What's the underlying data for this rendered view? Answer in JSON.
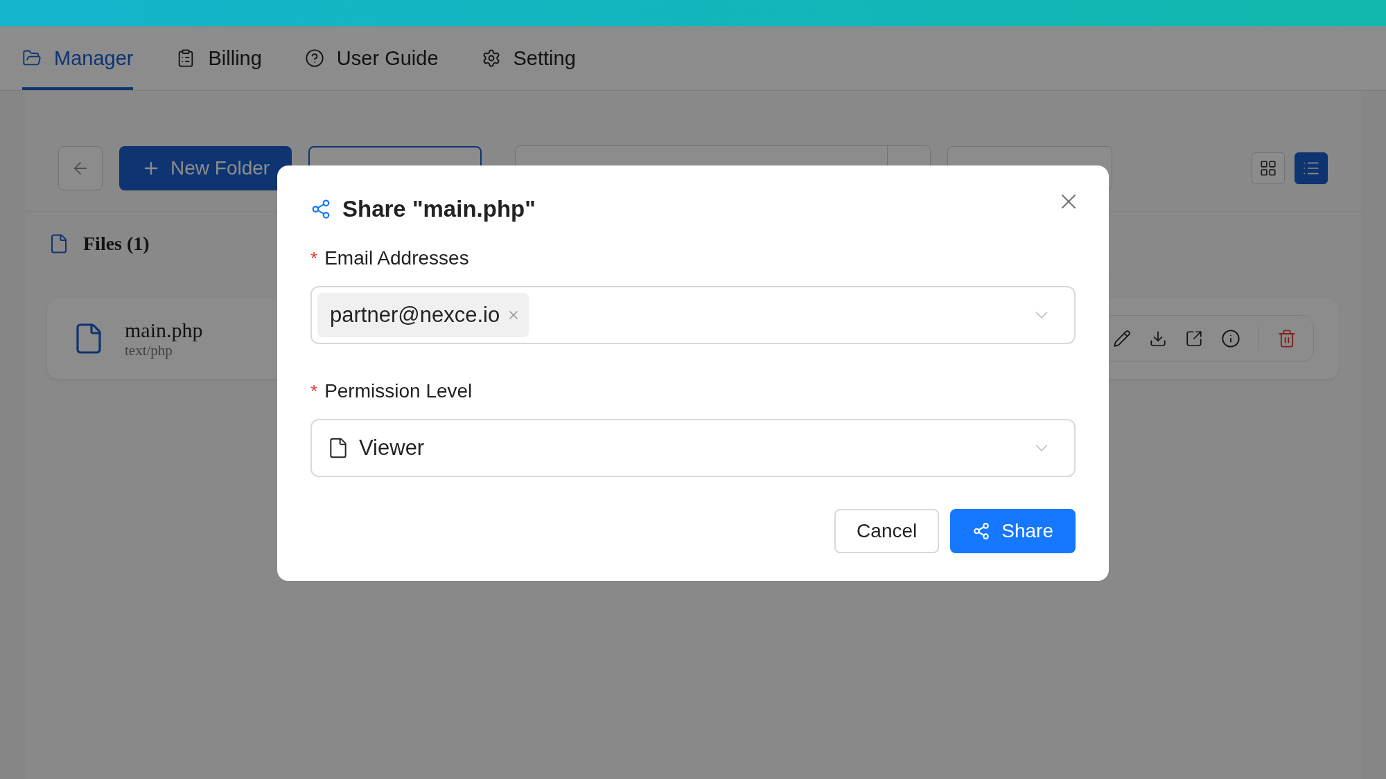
{
  "nav": {
    "tabs": [
      {
        "label": "Manager",
        "selected": true
      },
      {
        "label": "Billing",
        "selected": false
      },
      {
        "label": "User Guide",
        "selected": false
      },
      {
        "label": "Setting",
        "selected": false
      }
    ]
  },
  "toolbar": {
    "new_folder": "New Folder",
    "views": [
      {
        "selected": false
      },
      {
        "selected": true
      }
    ]
  },
  "files": {
    "title": "Files (1)",
    "items": [
      {
        "name": "main.php",
        "type": "text/php"
      }
    ]
  },
  "dialog": {
    "required_mark": "*",
    "title": "Share \"main.php\"",
    "fields": [
      {
        "kind": "tags",
        "label": "Email Addresses",
        "required": true,
        "tags": [
          "partner@nexce.io"
        ]
      },
      {
        "kind": "select",
        "label": "Permission Level",
        "required": true,
        "value": "Viewer"
      }
    ],
    "buttons": [
      {
        "kind": "default",
        "label": "Cancel"
      },
      {
        "kind": "primary",
        "label": "Share"
      }
    ]
  }
}
